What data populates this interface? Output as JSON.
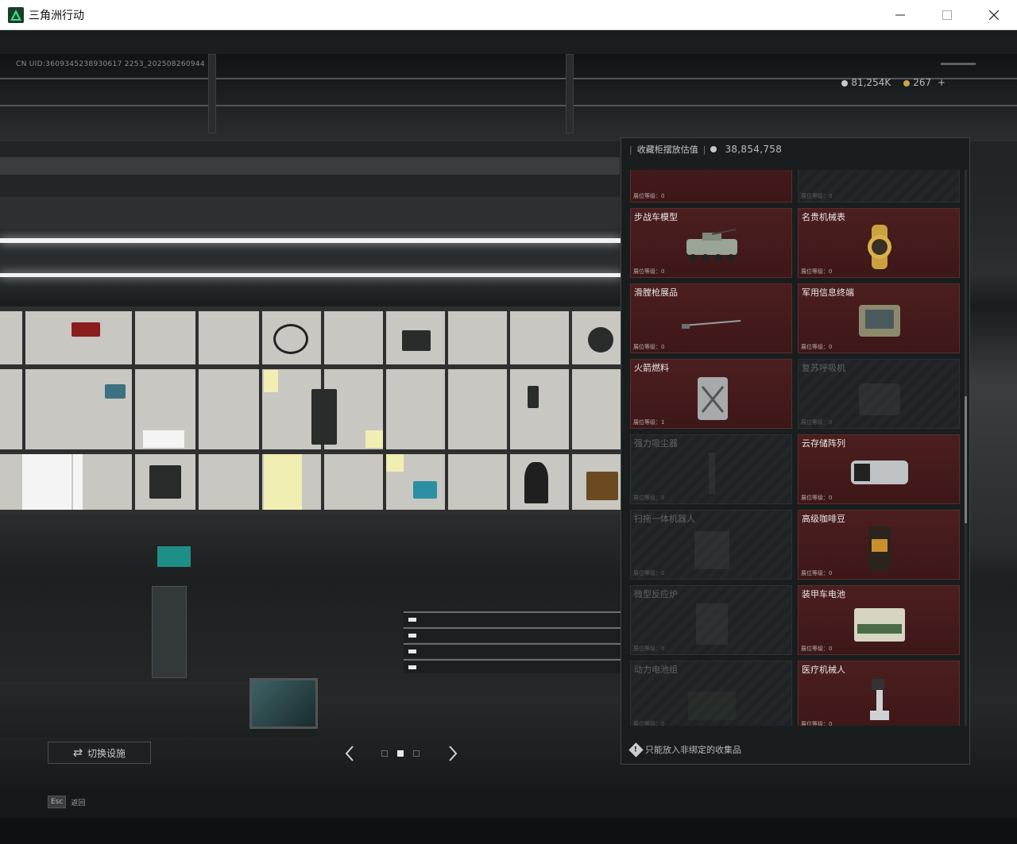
{
  "window": {
    "title": "三角洲行动",
    "icons": [
      "app-logo-icon",
      "minimize-icon",
      "maximize-icon",
      "close-icon"
    ]
  },
  "hud": {
    "uid": "CN UID:3609345238930617 2253_202508260944",
    "currency_silver": "81,254K",
    "currency_gold": "267",
    "add_symbol": "+"
  },
  "panel": {
    "title": "收藏柜摆放估值",
    "value": "38,854,758",
    "footer": "只能放入非绑定的收集品",
    "level_prefix": "展位等级：",
    "cards": [
      {
        "name": "",
        "level": "展位等级：0",
        "locked": false,
        "art": "card-frame"
      },
      {
        "name": "",
        "level": "展位等级：0",
        "locked": true,
        "art": "none"
      },
      {
        "name": "步战车模型",
        "level": "展位等级：0",
        "locked": false,
        "art": "ifv"
      },
      {
        "name": "名贵机械表",
        "level": "展位等级：0",
        "locked": false,
        "art": "watch"
      },
      {
        "name": "滑膛枪展品",
        "level": "展位等级：0",
        "locked": false,
        "art": "musket"
      },
      {
        "name": "军用信息终端",
        "level": "展位等级：0",
        "locked": false,
        "art": "terminal"
      },
      {
        "name": "火箭燃料",
        "level": "展位等级：1",
        "locked": false,
        "art": "jerrycan"
      },
      {
        "name": "复苏呼吸机",
        "level": "展位等级：0",
        "locked": true,
        "art": "case"
      },
      {
        "name": "强力吸尘器",
        "level": "展位等级：0",
        "locked": true,
        "art": "vacuum"
      },
      {
        "name": "云存储阵列",
        "level": "展位等级：0",
        "locked": false,
        "art": "storage"
      },
      {
        "name": "扫拖一体机器人",
        "level": "展位等级：0",
        "locked": true,
        "art": "robot-vac"
      },
      {
        "name": "高级咖啡豆",
        "level": "展位等级：0",
        "locked": false,
        "art": "coffee"
      },
      {
        "name": "微型反应炉",
        "level": "展位等级：0",
        "locked": true,
        "art": "reactor"
      },
      {
        "name": "装甲车电池",
        "level": "展位等级：0",
        "locked": false,
        "art": "battery"
      },
      {
        "name": "动力电池组",
        "level": "展位等级：0",
        "locked": true,
        "art": "battery-pack"
      },
      {
        "name": "医疗机械人",
        "level": "展位等级：0",
        "locked": false,
        "art": "med-robot"
      }
    ]
  },
  "controls": {
    "switch_facility": "切换设施",
    "esc_key": "Esc",
    "esc_label": "返回"
  },
  "colors": {
    "card_bg": "#4c1e1f",
    "card_border": "#57302f",
    "panel_bg": "#1a1d1e",
    "highlight_cell": "#f1eeb4"
  }
}
